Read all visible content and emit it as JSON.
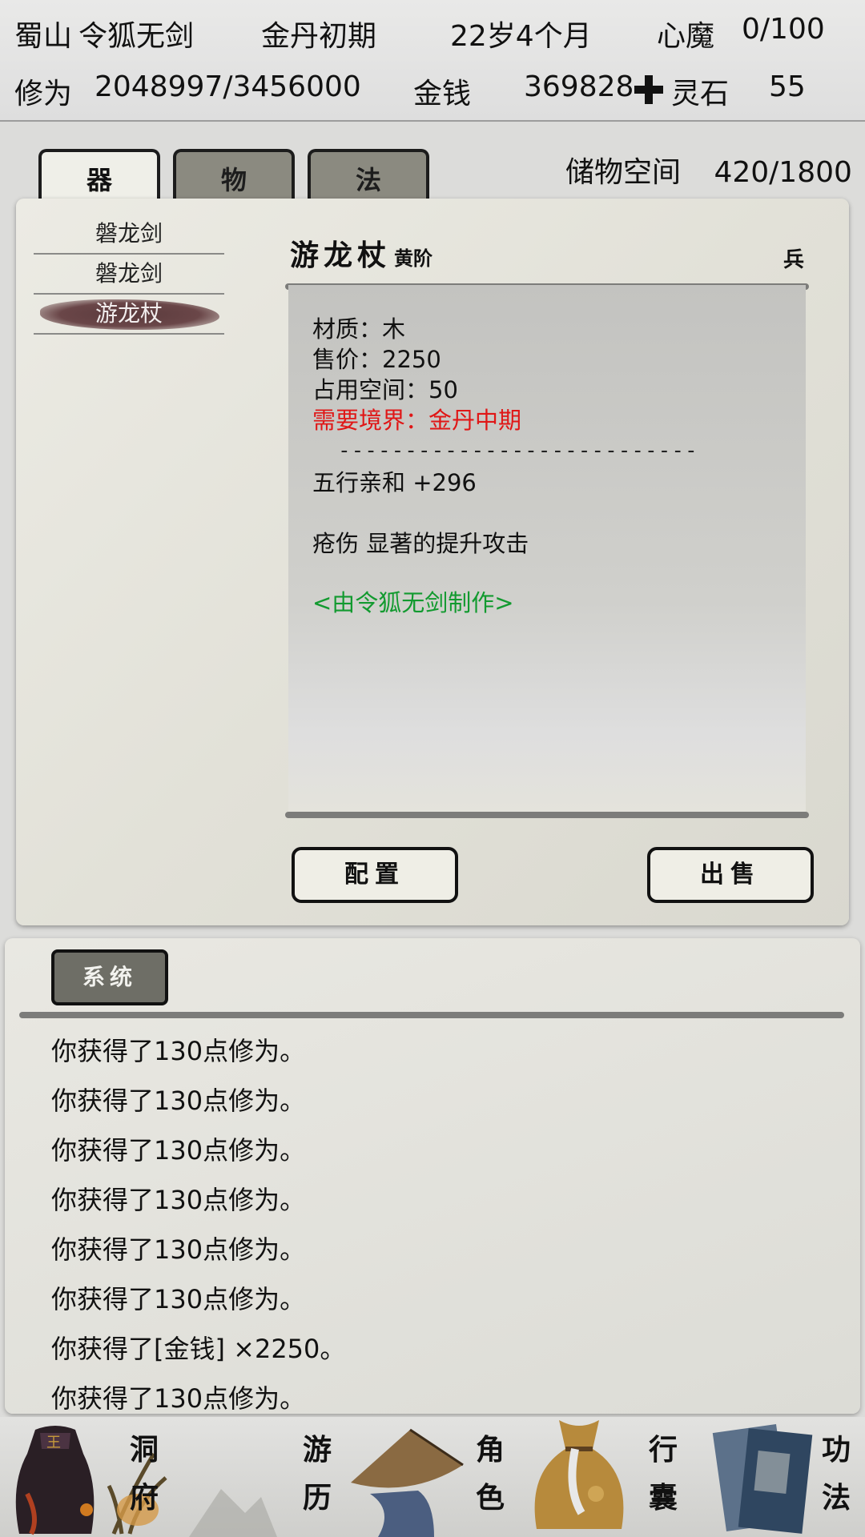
{
  "header": {
    "sect": "蜀山",
    "name": "令狐无剑",
    "realm": "金丹初期",
    "age": "22岁4个月",
    "demon_label": "心魔",
    "demon_value": "0/100",
    "cultivation_label": "修为",
    "cultivation_value": "2048997/3456000",
    "money_label": "金钱",
    "money_value": "369828",
    "spirit_stone_label": "灵石",
    "spirit_stone_value": "55"
  },
  "tabs": [
    {
      "label": "器",
      "active": true
    },
    {
      "label": "物",
      "active": false
    },
    {
      "label": "法",
      "active": false
    }
  ],
  "storage": {
    "label": "储物空间",
    "value": "420/1800"
  },
  "item_list": [
    {
      "name": "磐龙剑",
      "selected": false
    },
    {
      "name": "磐龙剑",
      "selected": false
    },
    {
      "name": "游龙杖",
      "selected": true
    }
  ],
  "item_detail": {
    "title": "游龙杖",
    "grade": "黄阶",
    "type": "兵",
    "material": "材质：木",
    "price": "售价：2250",
    "space": "占用空间：50",
    "requirement": "需要境界：金丹中期",
    "separator": "---------------------------",
    "affinity": "五行亲和 +296",
    "effect": "疮伤 显著的提升攻击",
    "crafted_by": "<由令狐无剑制作>"
  },
  "actions": {
    "equip": "配置",
    "sell": "出售"
  },
  "log": {
    "tab_label": "系统",
    "lines": [
      "你获得了130点修为。",
      "你获得了130点修为。",
      "你获得了130点修为。",
      "你获得了130点修为。",
      "你获得了130点修为。",
      "你获得了130点修为。",
      "你获得了[金钱] ×2250。",
      "你获得了130点修为。"
    ]
  },
  "nav": [
    {
      "line1": "洞",
      "line2": "府"
    },
    {
      "line1": "游",
      "line2": "历"
    },
    {
      "line1": "角",
      "line2": "色"
    },
    {
      "line1": "行",
      "line2": "囊"
    },
    {
      "line1": "功",
      "line2": "法"
    }
  ],
  "colors": {
    "requirement": "#e01616",
    "crafted_by": "#129a2f",
    "selected_item": "#5a3a3c"
  }
}
